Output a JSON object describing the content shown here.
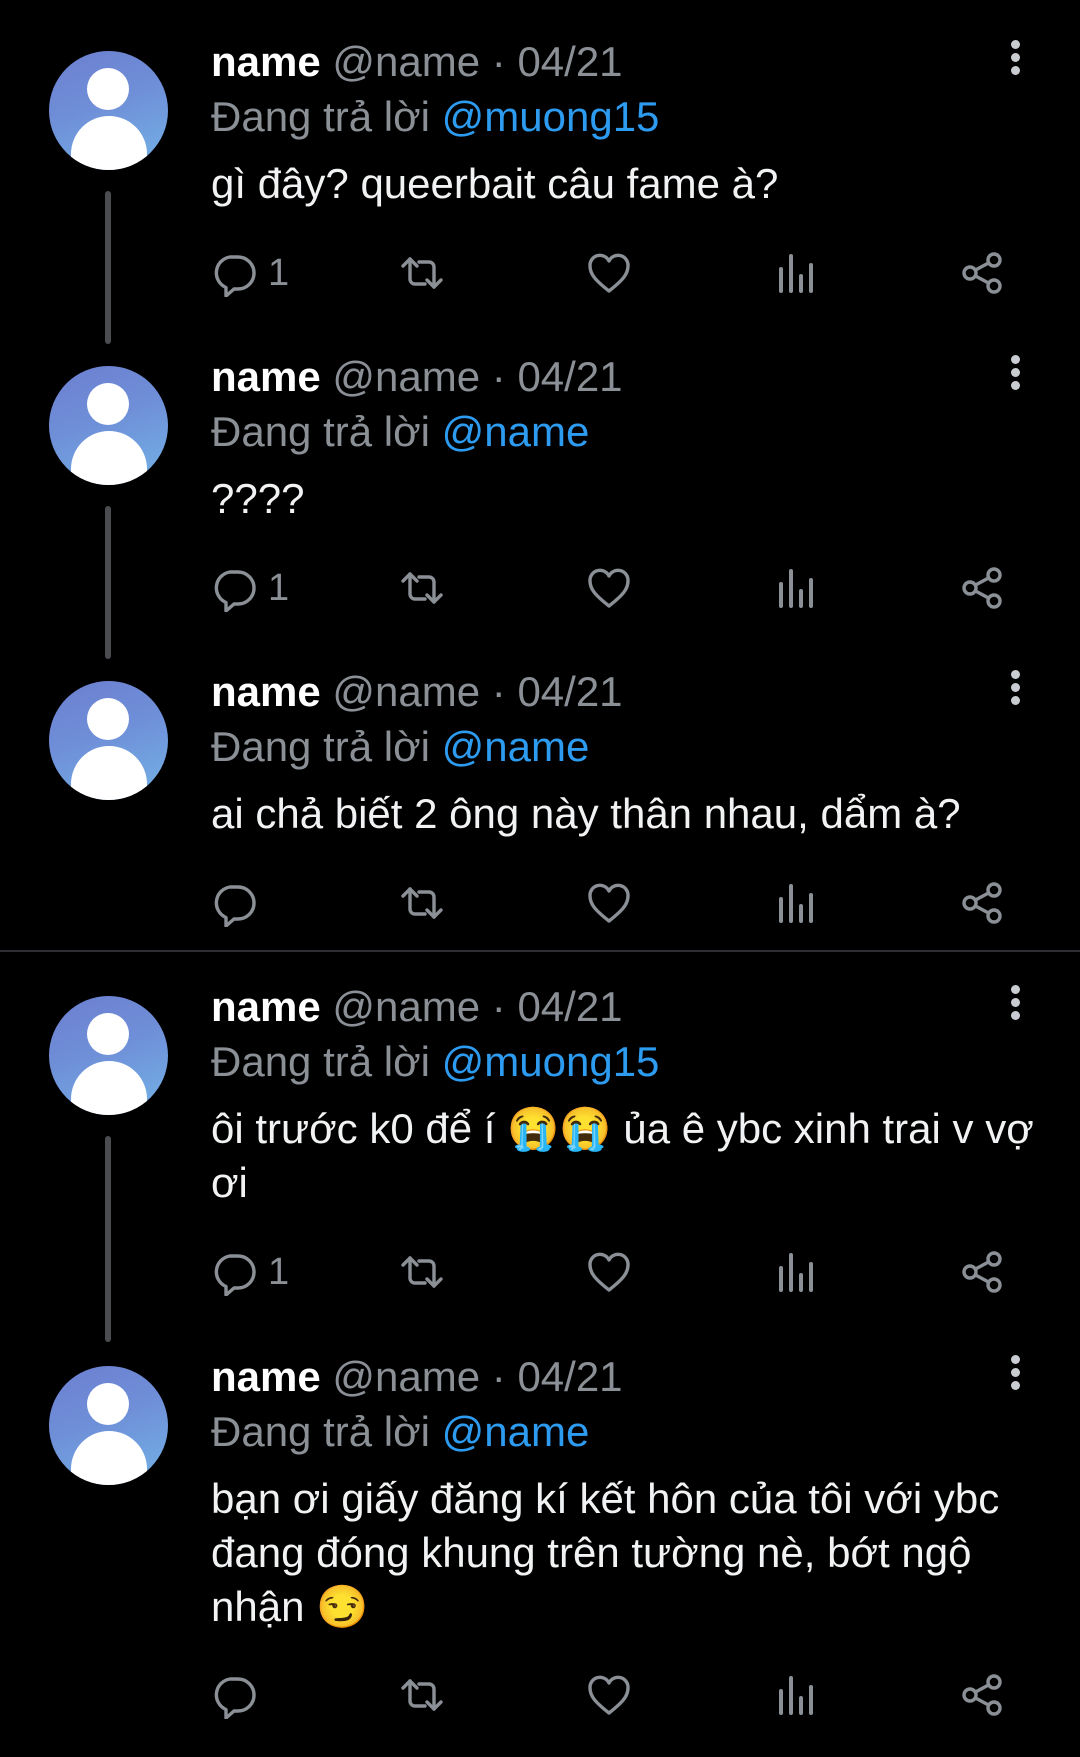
{
  "tweets": [
    {
      "name": "name",
      "handle": "@name",
      "dot": "·",
      "date": "04/21",
      "reply_prefix": "Đang trả lời",
      "reply_to": "@muong15",
      "text": "gì đây? queerbait câu fame à?",
      "reply_count": "1"
    },
    {
      "name": "name",
      "handle": "@name",
      "dot": "·",
      "date": "04/21",
      "reply_prefix": "Đang trả lời",
      "reply_to": "@name",
      "text": "????",
      "reply_count": "1"
    },
    {
      "name": "name",
      "handle": "@name",
      "dot": "·",
      "date": "04/21",
      "reply_prefix": "Đang trả lời",
      "reply_to": "@name",
      "text": "ai chả biết 2 ông này thân nhau, dẩm à?",
      "reply_count": ""
    },
    {
      "name": "name",
      "handle": "@name",
      "dot": "·",
      "date": "04/21",
      "reply_prefix": "Đang trả lời",
      "reply_to": "@muong15",
      "text": "ôi trước k0 để í 😭😭 ủa ê ybc xinh trai v vợ ơi",
      "reply_count": "1"
    },
    {
      "name": "name",
      "handle": "@name",
      "dot": "·",
      "date": "04/21",
      "reply_prefix": "Đang trả lời",
      "reply_to": "@name",
      "text": "bạn ơi giấy đăng kí kết hôn của tôi với ybc đang đóng khung trên tường nè, bớt ngộ nhận 😏",
      "reply_count": ""
    }
  ],
  "icons": {
    "reply": "reply-icon",
    "retweet": "retweet-icon",
    "like": "like-icon",
    "views": "views-icon",
    "share": "share-icon",
    "more": "more-vertical-icon",
    "avatar": "default-avatar-icon"
  },
  "colors": {
    "background": "#000000",
    "mention": "#2d9bf0",
    "muted": "#8b9096",
    "text": "#f1f2f3",
    "thread_line": "#4a4c50"
  }
}
